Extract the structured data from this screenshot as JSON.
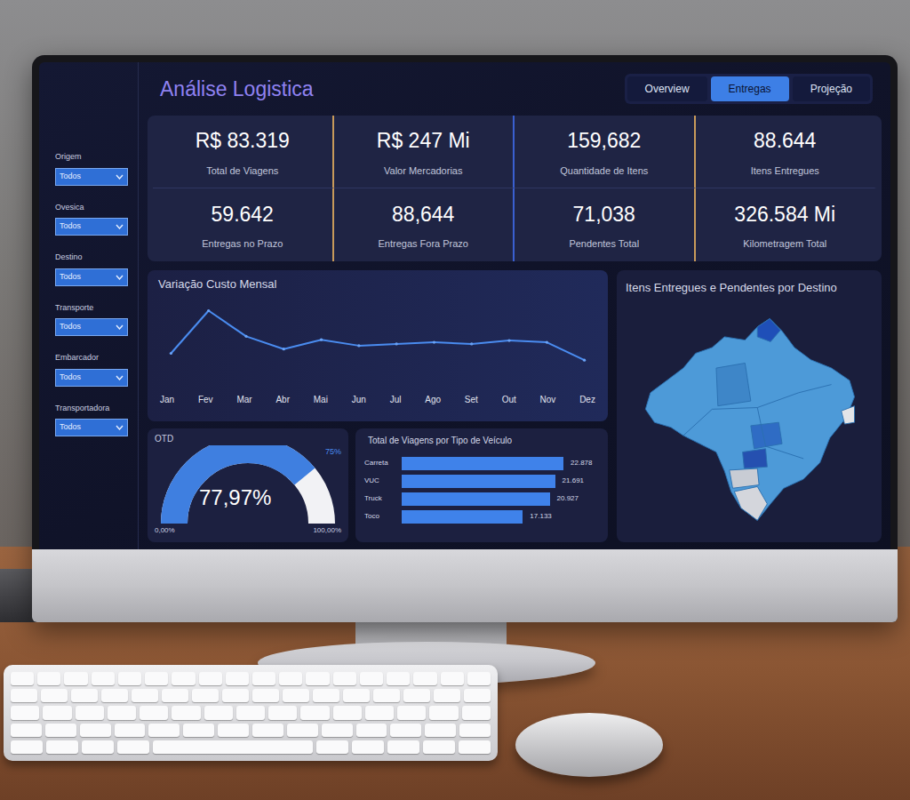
{
  "dashboard": {
    "title": "Análise Logistica",
    "tabs": [
      {
        "label": "Overview",
        "selected": false
      },
      {
        "label": "Entregas",
        "selected": true
      },
      {
        "label": "Projeção",
        "selected": false
      }
    ],
    "filters": [
      {
        "label": "Origem",
        "value": "Todos"
      },
      {
        "label": "Ovesica",
        "value": "Todos"
      },
      {
        "label": "Destino",
        "value": "Todos"
      },
      {
        "label": "Transporte",
        "value": "Todos"
      },
      {
        "label": "Embarcador",
        "value": "Todos"
      },
      {
        "label": "Transportadora",
        "value": "Todos"
      }
    ],
    "kpis": [
      {
        "value": "R$ 83.319",
        "label": "Total de Viagens"
      },
      {
        "value": "R$ 247 Mi",
        "label": "Valor Mercadorias"
      },
      {
        "value": "159,682",
        "label": "Quantidade de Itens"
      },
      {
        "value": "88.644",
        "label": "Itens Entregues"
      },
      {
        "value": "59.642",
        "label": "Entregas no Prazo"
      },
      {
        "value": "88,644",
        "label": "Entregas Fora Prazo"
      },
      {
        "value": "71,038",
        "label": "Pendentes Total"
      },
      {
        "value": "326.584 Mi",
        "label": "Kilometragem Total"
      }
    ],
    "line_chart": {
      "title": "Variação Custo Mensal",
      "months": [
        "Jan",
        "Fev",
        "Mar",
        "Abr",
        "Mai",
        "Jun",
        "Jul",
        "Ago",
        "Set",
        "Out",
        "Nov",
        "Dez"
      ],
      "values": [
        38,
        88,
        58,
        43,
        54,
        47,
        49,
        51,
        49,
        53,
        51,
        30
      ]
    },
    "map": {
      "title": "Itens Entregues e Pendentes por Destino"
    },
    "gauge": {
      "title": "OTD",
      "reading": "77,97%",
      "level": 0.7797,
      "min": "0,00%",
      "max": "100,00%",
      "target": "75%"
    },
    "bar_chart": {
      "title": "Total de Viagens por Tipo de Veículo",
      "bars": [
        {
          "label": "Carreta",
          "reading": "22.878",
          "value": 22878
        },
        {
          "label": "VUC",
          "reading": "21.691",
          "value": 21691
        },
        {
          "label": "Truck",
          "reading": "20.927",
          "value": 20927
        },
        {
          "label": "Toco",
          "reading": "17.133",
          "value": 17133
        }
      ]
    }
  }
}
